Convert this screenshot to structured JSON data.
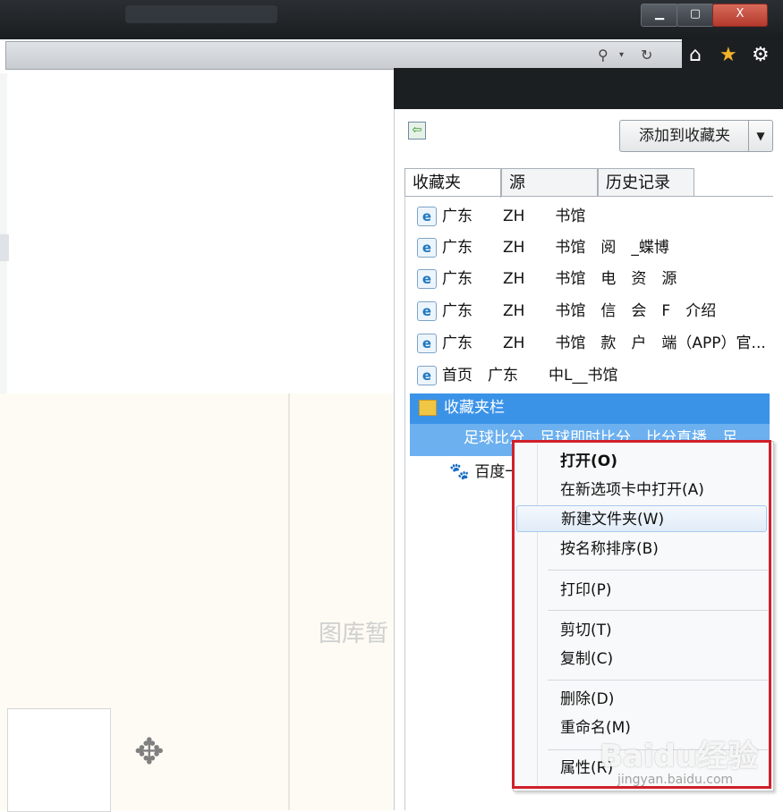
{
  "window": {
    "min_label": "▁",
    "max_label": "▢",
    "close_label": "X"
  },
  "toolbar": {
    "dropdown": "▾",
    "home": "⌂",
    "star": "★",
    "gear": "⚙"
  },
  "content": {
    "hint_text": "图库暂"
  },
  "favorites_pane": {
    "add_button": "添加到收藏夹",
    "add_dropdown": "▼",
    "tabs": [
      "收藏夹",
      "源",
      "历史记录"
    ],
    "items": [
      {
        "icon": "ie-page-icon",
        "label": "广东　　ZH　　书馆"
      },
      {
        "icon": "ie-page-icon",
        "label": "广东　　ZH　　书馆　阅　_蝶博"
      },
      {
        "icon": "ie-page-icon",
        "label": "广东　　ZH　　书馆　电　资　源"
      },
      {
        "icon": "ie-page-icon",
        "label": "广东　　ZH　　书馆　信　会　F　介绍"
      },
      {
        "icon": "ie-page-icon",
        "label": "广东　　ZH　　书馆　款　户　端（APP）官..."
      },
      {
        "icon": "ie-page-icon",
        "label": "首页　广东　　中L__书馆"
      }
    ],
    "folder": {
      "label": "收藏夹栏"
    },
    "folder_child": {
      "label": "足球比分　足球即时比分　比分直播　足"
    },
    "baidu_item": {
      "label": "百度一"
    }
  },
  "context_menu": {
    "items": [
      {
        "key": "open",
        "label": "打开(O)"
      },
      {
        "key": "open_newtab",
        "label": "在新选项卡中打开(A)"
      },
      {
        "key": "new_folder",
        "label": "新建文件夹(W)"
      },
      {
        "key": "sort",
        "label": "按名称排序(B)"
      },
      {
        "key": "print",
        "label": "打印(P)"
      },
      {
        "key": "cut",
        "label": "剪切(T)"
      },
      {
        "key": "copy",
        "label": "复制(C)"
      },
      {
        "key": "delete",
        "label": "删除(D)"
      },
      {
        "key": "rename",
        "label": "重命名(M)"
      },
      {
        "key": "props",
        "label": "属性(R)"
      }
    ]
  },
  "watermark": {
    "logo": "Baidu经验",
    "url": "jingyan.baidu.com"
  },
  "colors": {
    "selection": "#3b93e8",
    "highlight_border": "#d0202a",
    "star": "#f3b32a"
  }
}
